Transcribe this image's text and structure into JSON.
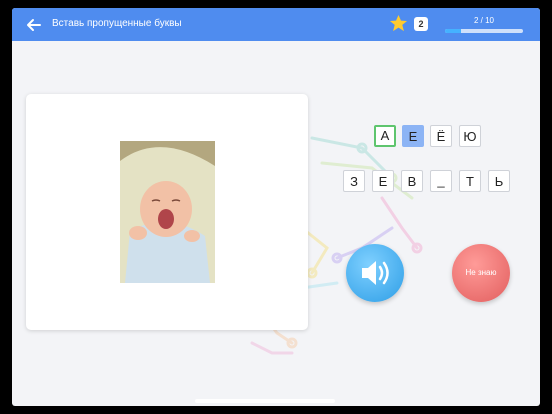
{
  "header": {
    "title": "Вставь пропущенные буквы",
    "coins": "2",
    "progress_text": "2 / 10",
    "progress_fraction": 0.2
  },
  "options": [
    "А",
    "Е",
    "Ё",
    "Ю"
  ],
  "word": [
    "З",
    "Е",
    "В",
    "_",
    "Т",
    "Ь"
  ],
  "buttons": {
    "dont_know": "Не знаю"
  },
  "colors": {
    "header": "#4f8cef",
    "accent_green": "#5ec56e",
    "highlight": "#8cb4f5",
    "red": "#e25e5e"
  }
}
